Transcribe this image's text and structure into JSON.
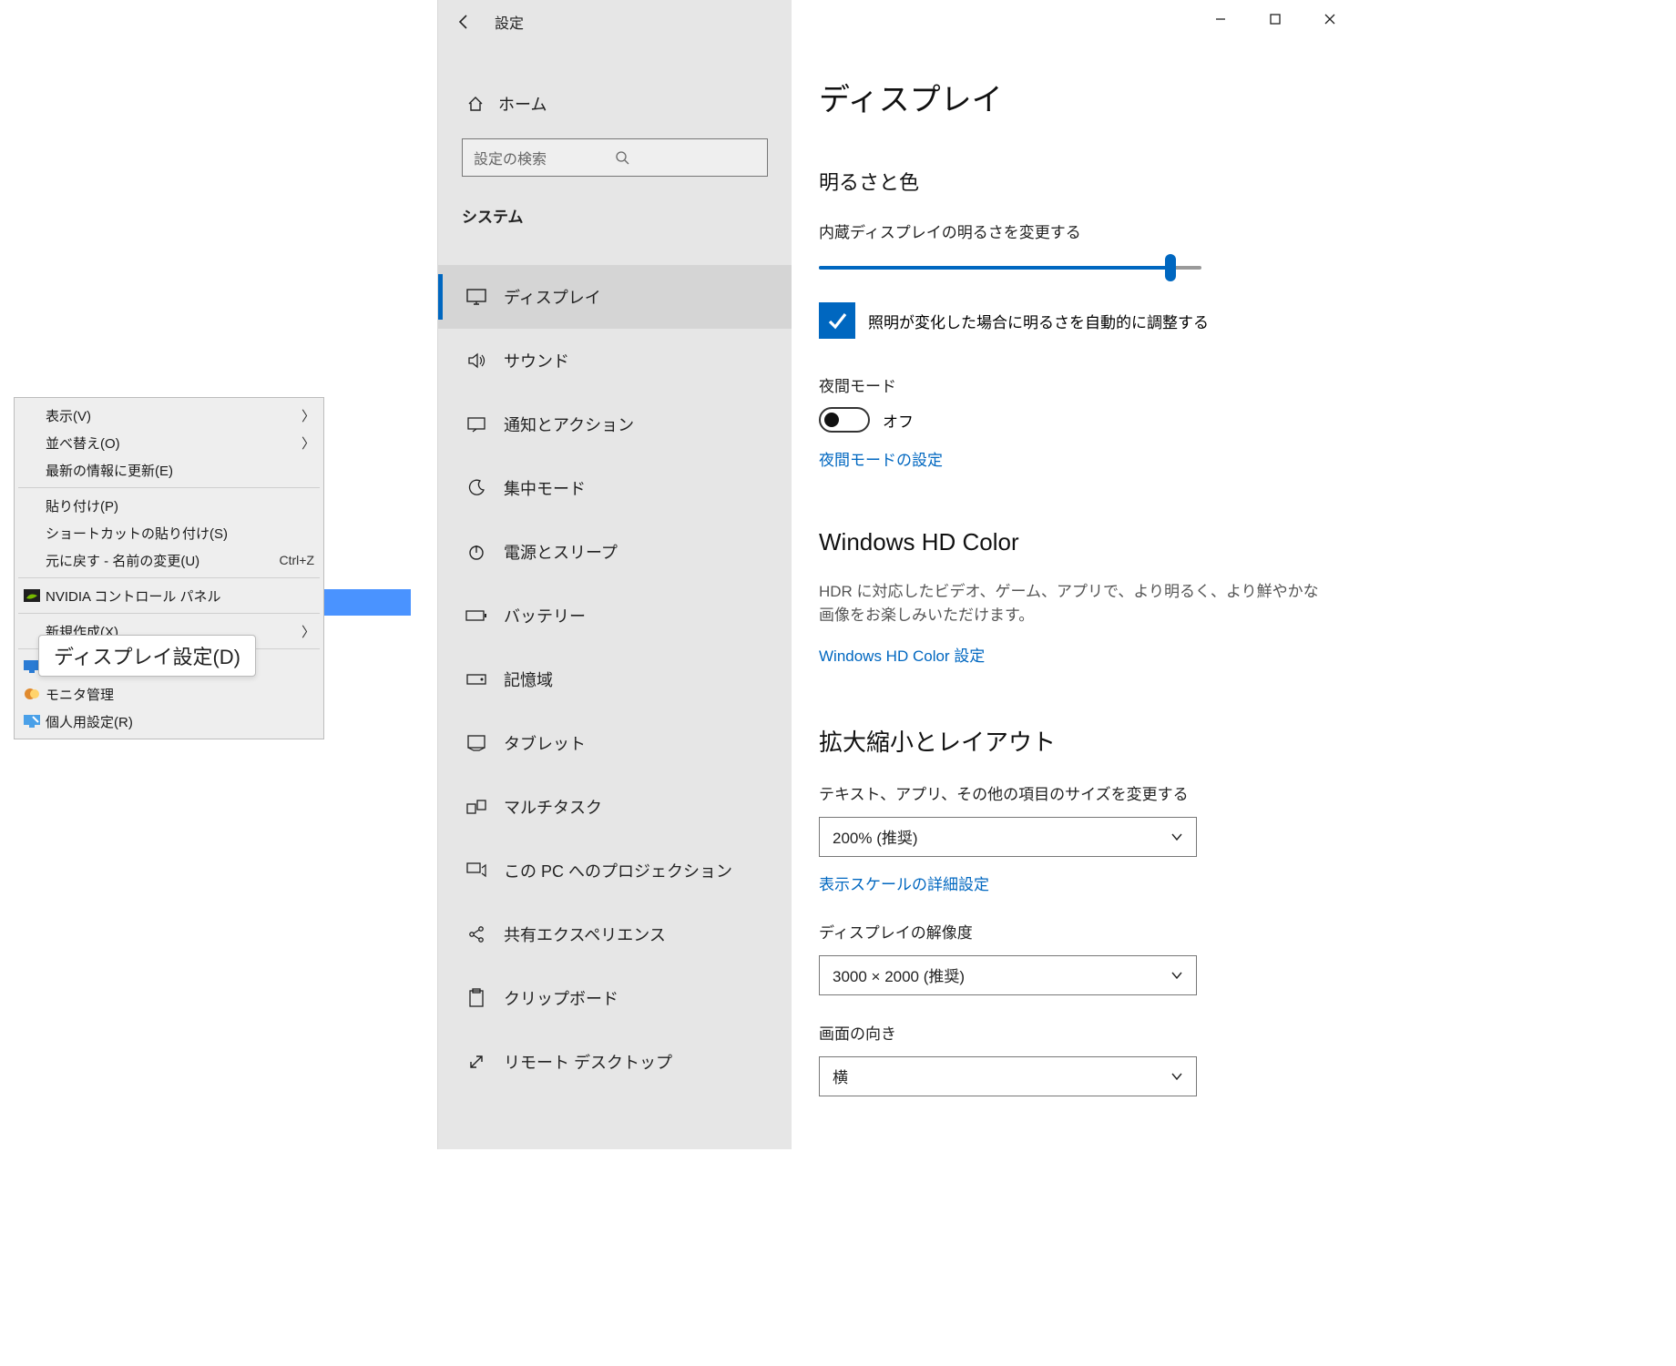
{
  "context_menu": {
    "items": [
      {
        "label": "表示(V)",
        "arrow": true
      },
      {
        "label": "並べ替え(O)",
        "arrow": true
      },
      {
        "label": "最新の情報に更新(E)"
      },
      {
        "sep": true
      },
      {
        "label": "貼り付け(P)"
      },
      {
        "label": "ショートカットの貼り付け(S)"
      },
      {
        "label": "元に戻す - 名前の変更(U)",
        "shortcut": "Ctrl+Z"
      },
      {
        "sep": true
      },
      {
        "label": "NVIDIA コントロール パネル",
        "icon": "nvidia"
      },
      {
        "sep": true
      },
      {
        "label": "新規作成(X)",
        "arrow": true
      },
      {
        "sep": true
      },
      {
        "label": "ディスプレイ設定(D)",
        "icon": "display-blue"
      },
      {
        "label": "モニタ管理",
        "icon": "monitor-orange"
      },
      {
        "label": "個人用設定(R)",
        "icon": "personalize"
      }
    ]
  },
  "tooltip": "ディスプレイ設定(D)",
  "settings": {
    "app_title": "設定",
    "home": "ホーム",
    "search_placeholder": "設定の検索",
    "category": "システム",
    "nav": [
      {
        "label": "ディスプレイ",
        "icon": "display",
        "active": true
      },
      {
        "label": "サウンド",
        "icon": "sound"
      },
      {
        "label": "通知とアクション",
        "icon": "notify"
      },
      {
        "label": "集中モード",
        "icon": "moon"
      },
      {
        "label": "電源とスリープ",
        "icon": "power"
      },
      {
        "label": "バッテリー",
        "icon": "battery"
      },
      {
        "label": "記憶域",
        "icon": "storage"
      },
      {
        "label": "タブレット",
        "icon": "tablet"
      },
      {
        "label": "マルチタスク",
        "icon": "multitask"
      },
      {
        "label": "この PC へのプロジェクション",
        "icon": "project"
      },
      {
        "label": "共有エクスペリエンス",
        "icon": "share"
      },
      {
        "label": "クリップボード",
        "icon": "clipboard"
      },
      {
        "label": "リモート デスクトップ",
        "icon": "remote"
      }
    ],
    "content": {
      "page_title": "ディスプレイ",
      "brightness_section": "明るさと色",
      "brightness_label": "内蔵ディスプレイの明るさを変更する",
      "brightness_value": 92,
      "auto_brightness": "照明が変化した場合に明るさを自動的に調整する",
      "night_mode_title": "夜間モード",
      "night_mode_value": "オフ",
      "night_mode_link": "夜間モードの設定",
      "hdcolor_title": "Windows HD Color",
      "hdcolor_desc": "HDR に対応したビデオ、ゲーム、アプリで、より明るく、より鮮やかな画像をお楽しみいただけます。",
      "hdcolor_link": "Windows HD Color 設定",
      "scale_title": "拡大縮小とレイアウト",
      "scale_label": "テキスト、アプリ、その他の項目のサイズを変更する",
      "scale_value": "200% (推奨)",
      "scale_link": "表示スケールの詳細設定",
      "resolution_label": "ディスプレイの解像度",
      "resolution_value": "3000 × 2000 (推奨)",
      "orientation_label": "画面の向き",
      "orientation_value": "横"
    }
  }
}
